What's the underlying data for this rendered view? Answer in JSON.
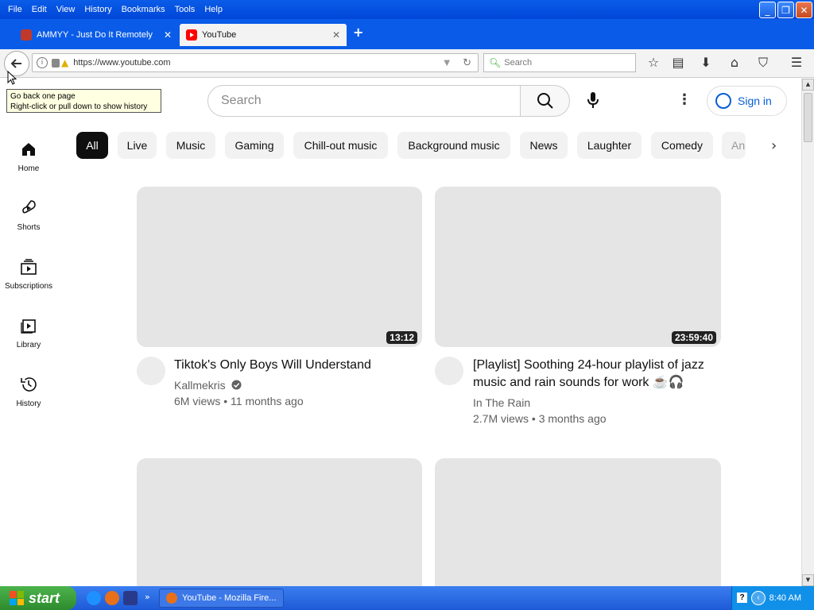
{
  "menubar": {
    "items": [
      "File",
      "Edit",
      "View",
      "History",
      "Bookmarks",
      "Tools",
      "Help"
    ]
  },
  "window_controls": {
    "minimize": "_",
    "restore": "❐",
    "close": "✕"
  },
  "tabs": [
    {
      "label": "AMMYY - Just Do It Remotely",
      "active": false,
      "close": "✕"
    },
    {
      "label": "YouTube",
      "active": true,
      "close": "✕"
    }
  ],
  "new_tab": "+",
  "navbar": {
    "url": "https://www.youtube.com",
    "search_placeholder": "Search"
  },
  "tooltip": {
    "line1": "Go back one page",
    "line2": "Right-click or pull down to show history"
  },
  "youtube": {
    "search_placeholder": "Search",
    "sign_in": "Sign in",
    "chips": [
      "All",
      "Live",
      "Music",
      "Gaming",
      "Chill-out music",
      "Background music",
      "News",
      "Laughter",
      "Comedy",
      "An"
    ],
    "sidebar": [
      {
        "label": "Home",
        "icon": "home-icon"
      },
      {
        "label": "Shorts",
        "icon": "shorts-icon"
      },
      {
        "label": "Subscriptions",
        "icon": "subscriptions-icon"
      },
      {
        "label": "Library",
        "icon": "library-icon"
      },
      {
        "label": "History",
        "icon": "history-icon"
      }
    ],
    "videos": [
      {
        "title": "Tiktok's Only Boys Will Understand",
        "channel": "Kallmekris",
        "verified": true,
        "meta": "6M views • 11 months ago",
        "duration": "13:12"
      },
      {
        "title": "[Playlist] Soothing 24-hour playlist of jazz music and rain sounds for work ☕🎧",
        "channel": "In The Rain",
        "verified": false,
        "meta": "2.7M views • 3 months ago",
        "duration": "23:59:40"
      }
    ]
  },
  "taskbar": {
    "start": "start",
    "task_label": "YouTube - Mozilla Fire...",
    "clock": "8:40 AM"
  },
  "colors": {
    "xp_blue": "#0a5ce8",
    "youtube_red": "#ff0000",
    "link_blue": "#065fd4",
    "chip_selected": "#0f0f0f",
    "thumb_placeholder": "#e5e5e5"
  }
}
